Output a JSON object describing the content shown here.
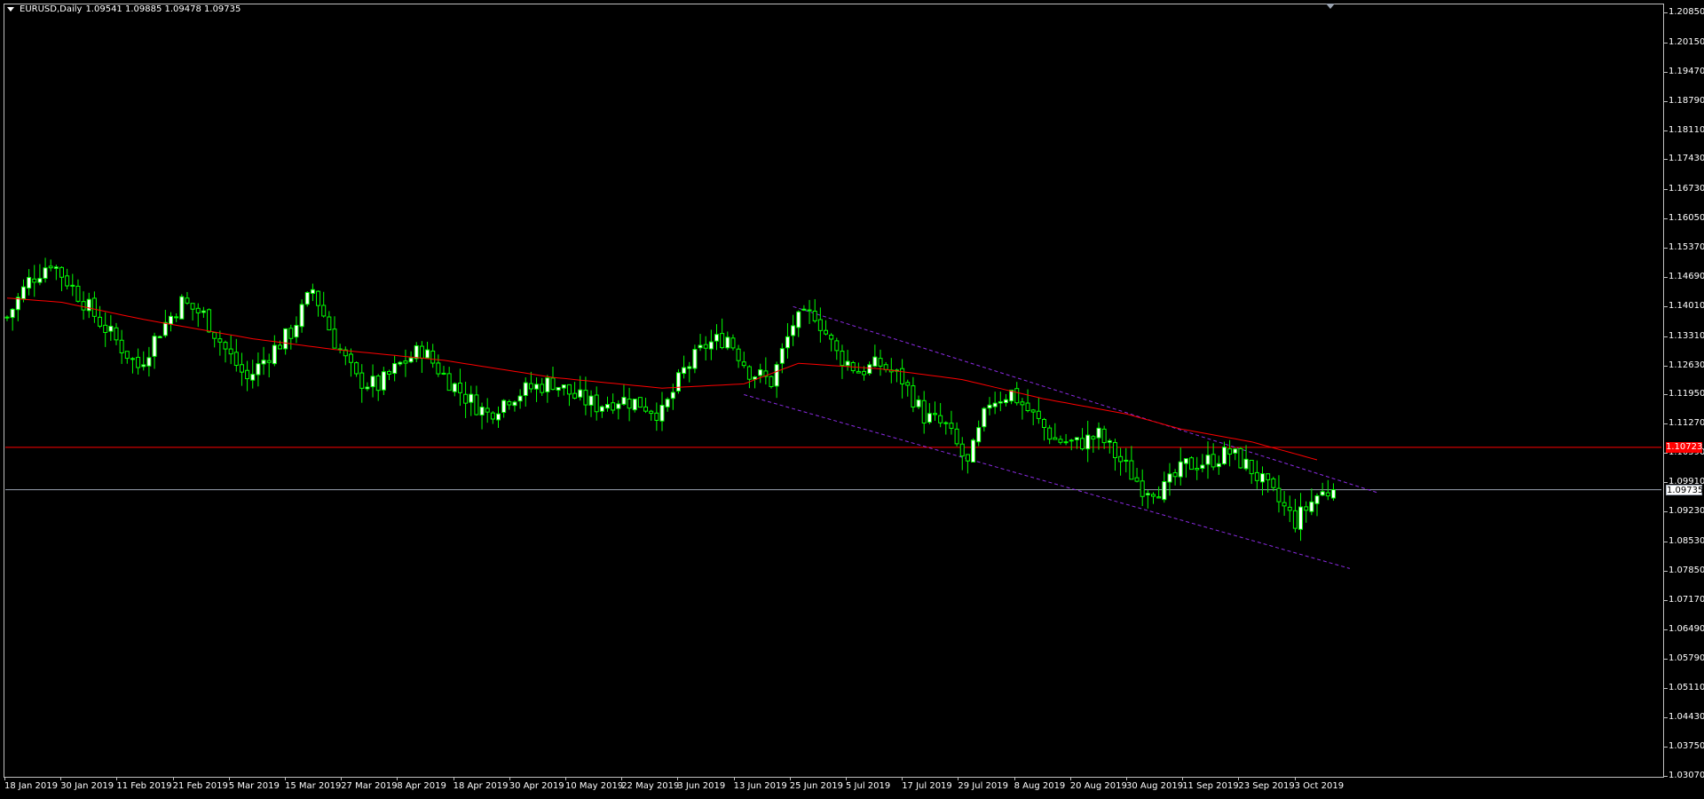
{
  "window": {
    "symbol_label": "EURUSD,Daily",
    "ohlc_text": "1.09541 1.09885 1.09478 1.09735"
  },
  "colors": {
    "background": "#000000",
    "foreground": "#ffffff",
    "bull_candle": "#ffffff",
    "bear_candle": "#000000",
    "wick": "#00ff00",
    "moving_average": "#ff0000",
    "horizontal_level": "#ff0000",
    "bid_line": "#9aa3b0",
    "channel": "#8a2be2"
  },
  "price_axis": {
    "labels": [
      "1.20850",
      "1.20150",
      "1.19470",
      "1.18790",
      "1.18110",
      "1.17430",
      "1.16730",
      "1.16050",
      "1.15370",
      "1.14690",
      "1.14010",
      "1.13310",
      "1.12630",
      "1.11950",
      "1.11270",
      "1.10590",
      "1.09910",
      "1.09230",
      "1.08530",
      "1.07850",
      "1.07170",
      "1.06490",
      "1.05790",
      "1.05110",
      "1.04430",
      "1.03750",
      "1.03070"
    ],
    "bid_price": "1.09735",
    "level_price": "1.10723",
    "min": 1.0307,
    "max": 1.2085
  },
  "time_axis": {
    "labels": [
      "18 Jan 2019",
      "30 Jan 2019",
      "11 Feb 2019",
      "21 Feb 2019",
      "5 Mar 2019",
      "15 Mar 2019",
      "27 Mar 2019",
      "8 Apr 2019",
      "18 Apr 2019",
      "30 Apr 2019",
      "10 May 2019",
      "22 May 2019",
      "3 Jun 2019",
      "13 Jun 2019",
      "25 Jun 2019",
      "5 Jul 2019",
      "17 Jul 2019",
      "29 Jul 2019",
      "8 Aug 2019",
      "20 Aug 2019",
      "30 Aug 2019",
      "11 Sep 2019",
      "23 Sep 2019",
      "3 Oct 2019"
    ]
  },
  "chart_data": {
    "type": "candlestick",
    "symbol": "EURUSD",
    "timeframe": "Daily",
    "last_bar": {
      "open": 1.09541,
      "high": 1.09885,
      "low": 1.09478,
      "close": 1.09735
    },
    "y_range": [
      1.0307,
      1.2085
    ],
    "close_anchors": [
      [
        0,
        1.1375
      ],
      [
        4,
        1.146
      ],
      [
        8,
        1.1505
      ],
      [
        12,
        1.1445
      ],
      [
        16,
        1.138
      ],
      [
        20,
        1.132
      ],
      [
        24,
        1.126
      ],
      [
        28,
        1.1345
      ],
      [
        32,
        1.141
      ],
      [
        36,
        1.138
      ],
      [
        40,
        1.13
      ],
      [
        44,
        1.123
      ],
      [
        48,
        1.129
      ],
      [
        52,
        1.134
      ],
      [
        56,
        1.144
      ],
      [
        60,
        1.132
      ],
      [
        64,
        1.123
      ],
      [
        68,
        1.1215
      ],
      [
        72,
        1.1265
      ],
      [
        76,
        1.13
      ],
      [
        80,
        1.124
      ],
      [
        84,
        1.119
      ],
      [
        88,
        1.115
      ],
      [
        92,
        1.119
      ],
      [
        96,
        1.121
      ],
      [
        100,
        1.1225
      ],
      [
        104,
        1.119
      ],
      [
        108,
        1.117
      ],
      [
        112,
        1.1185
      ],
      [
        116,
        1.1175
      ],
      [
        120,
        1.115
      ],
      [
        124,
        1.125
      ],
      [
        128,
        1.131
      ],
      [
        132,
        1.133
      ],
      [
        136,
        1.125
      ],
      [
        140,
        1.1225
      ],
      [
        144,
        1.136
      ],
      [
        148,
        1.1385
      ],
      [
        152,
        1.129
      ],
      [
        156,
        1.125
      ],
      [
        160,
        1.1265
      ],
      [
        164,
        1.123
      ],
      [
        168,
        1.1145
      ],
      [
        172,
        1.112
      ],
      [
        176,
        1.103
      ],
      [
        180,
        1.118
      ],
      [
        184,
        1.12
      ],
      [
        188,
        1.1145
      ],
      [
        192,
        1.109
      ],
      [
        196,
        1.108
      ],
      [
        200,
        1.11
      ],
      [
        204,
        1.104
      ],
      [
        208,
        1.098
      ],
      [
        212,
        1.0975
      ],
      [
        216,
        1.103
      ],
      [
        220,
        1.104
      ],
      [
        224,
        1.106
      ],
      [
        228,
        1.102
      ],
      [
        232,
        1.096
      ],
      [
        236,
        1.09
      ],
      [
        240,
        1.096
      ],
      [
        243,
        1.0974
      ]
    ],
    "moving_average_anchors": [
      [
        0,
        1.142
      ],
      [
        10,
        1.141
      ],
      [
        25,
        1.137
      ],
      [
        45,
        1.1325
      ],
      [
        60,
        1.13
      ],
      [
        80,
        1.1275
      ],
      [
        100,
        1.1235
      ],
      [
        120,
        1.121
      ],
      [
        135,
        1.122
      ],
      [
        145,
        1.1268
      ],
      [
        160,
        1.1255
      ],
      [
        175,
        1.123
      ],
      [
        190,
        1.1185
      ],
      [
        205,
        1.115
      ],
      [
        215,
        1.1115
      ],
      [
        228,
        1.1085
      ],
      [
        240,
        1.1043
      ]
    ],
    "horizontal_level": 1.10723,
    "bid_line": 1.09735,
    "channel_upper": [
      [
        144,
        1.14
      ],
      [
        251,
        1.0967
      ]
    ],
    "channel_lower": [
      [
        135,
        1.1195
      ],
      [
        246,
        1.079
      ]
    ]
  }
}
